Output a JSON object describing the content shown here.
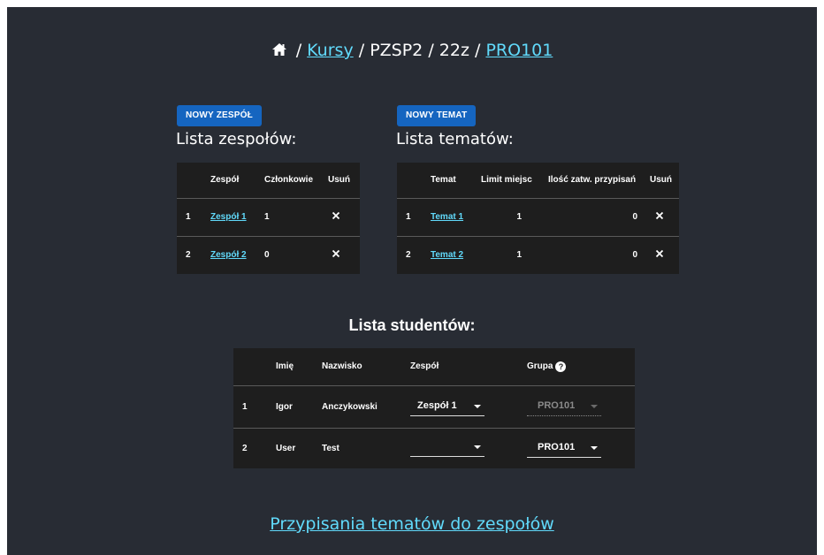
{
  "breadcrumb": {
    "home_icon": "home-icon",
    "sep": "/",
    "kursy": "Kursy",
    "course": "PZSP2",
    "semester": "22z",
    "code": "PRO101"
  },
  "teams": {
    "new_button": "NOWY ZESPÓŁ",
    "title": "Lista zespołów:",
    "headers": [
      "Zespół",
      "Członkowie",
      "Usuń"
    ],
    "rows": [
      {
        "index": "1",
        "name": "Zespół 1",
        "members": "1"
      },
      {
        "index": "2",
        "name": "Zespół 2",
        "members": "0"
      }
    ]
  },
  "topics": {
    "new_button": "NOWY TEMAT",
    "title": "Lista tematów:",
    "headers": [
      "Temat",
      "Limit miejsc",
      "Ilość zatw. przypisań",
      "Usuń"
    ],
    "rows": [
      {
        "index": "1",
        "name": "Temat 1",
        "limit": "1",
        "approved": "0"
      },
      {
        "index": "2",
        "name": "Temat 2",
        "limit": "1",
        "approved": "0"
      }
    ]
  },
  "students": {
    "title": "Lista studentów:",
    "headers": [
      "Imię",
      "Nazwisko",
      "Zespół",
      "Grupa"
    ],
    "help_icon": "question-circle-icon",
    "rows": [
      {
        "index": "1",
        "first": "Igor",
        "last": "Anczykowski",
        "team": "Zespół 1",
        "group": "PRO101",
        "group_disabled": true
      },
      {
        "index": "2",
        "first": "User",
        "last": "Test",
        "team": "",
        "group": "PRO101",
        "group_disabled": false
      }
    ]
  },
  "footer": {
    "link": "Przypisania tematów do zespołów"
  },
  "colors": {
    "background": "#282c34",
    "table": "#1e1e1e",
    "link": "#61dafb",
    "button": "#1565c0"
  }
}
